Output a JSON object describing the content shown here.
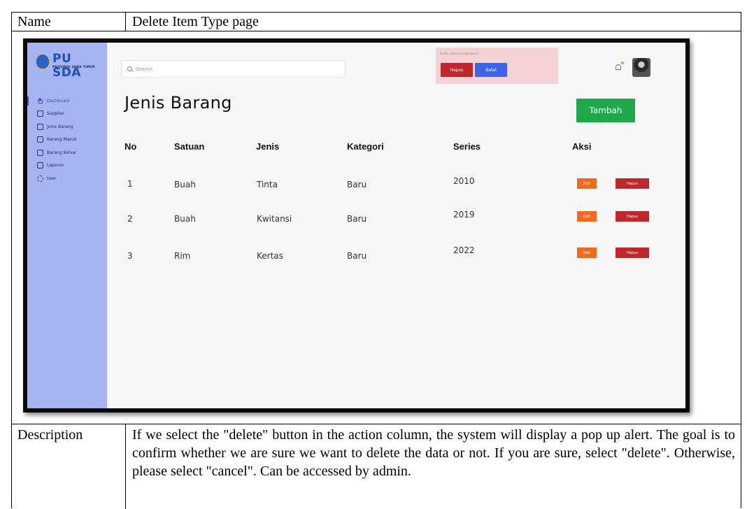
{
  "table": {
    "name_label": "Name",
    "name_value": "Delete Item Type page",
    "description_label": "Description",
    "description_text": "If we select the \"delete\" button in the action column, the system will display a pop up alert. The goal is to confirm whether we are sure we want to delete the data or not. If you are sure, select \"delete\". Otherwise, please select \"cancel\". Can be accessed by admin."
  },
  "mockup": {
    "logo": {
      "title": "PU SDA",
      "subtitle": "PROVINSI JAWA TIMUR"
    },
    "sidebar": {
      "items": [
        {
          "label": "Dashboard",
          "icon": "home-icon",
          "active": true
        },
        {
          "label": "Supplier",
          "icon": "supplier-icon"
        },
        {
          "label": "Jenis Barang",
          "icon": "folder-icon"
        },
        {
          "label": "Barang Masuk",
          "icon": "import-icon"
        },
        {
          "label": "Barang Keluar",
          "icon": "export-icon"
        },
        {
          "label": "Laporan",
          "icon": "report-icon"
        },
        {
          "label": "User",
          "icon": "gear-icon"
        }
      ]
    },
    "search": {
      "placeholder": "Search"
    },
    "popup": {
      "message": "Anda yakin menghapus?",
      "confirm_label": "Hapus",
      "cancel_label": "Batal",
      "confirm_color": "#c0272d",
      "cancel_color": "#3c63e8"
    },
    "page_title": "Jenis Barang",
    "add_button": "Tambah",
    "columns": [
      "No",
      "Satuan",
      "Jenis",
      "Kategori",
      "Series",
      "Aksi"
    ],
    "rows": [
      {
        "no": "1",
        "satuan": "Buah",
        "jenis": "Tinta",
        "kategori": "Baru",
        "series": "2010",
        "edit": "Edit",
        "hapus": "Hapus"
      },
      {
        "no": "2",
        "satuan": "Buah",
        "jenis": "Kwitansi",
        "kategori": "Baru",
        "series": "2019",
        "edit": "Edit",
        "hapus": "Hapus"
      },
      {
        "no": "3",
        "satuan": "Rim",
        "jenis": "Kertas",
        "kategori": "Baru",
        "series": "2022",
        "edit": "Edit",
        "hapus": "Hapus"
      }
    ],
    "colors": {
      "sidebar": "#a7b4f3",
      "accent": "#3b4ec8",
      "add": "#1fa84a",
      "edit": "#f26b1d",
      "delete": "#c0272d"
    }
  }
}
